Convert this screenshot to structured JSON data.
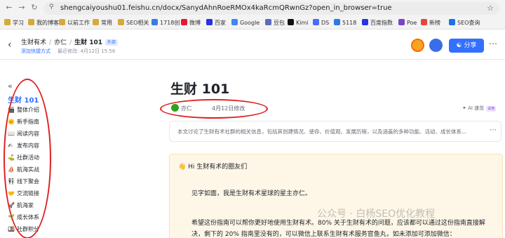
{
  "browser": {
    "url": "shengcaiyoushu01.feishu.cn/docx/SanydAhnRoeRMOx4kaRcmQRwnGz?open_in_browser=true",
    "bookmarks": [
      "学习",
      "我的博客",
      "以前工作",
      "常用",
      "SEO相关",
      "1718创",
      "微博",
      "百家",
      "Google",
      "豆包",
      "Kimi",
      "DS",
      "5118",
      "百度指数",
      "Poe",
      "新榜",
      "SEO查询"
    ]
  },
  "header": {
    "breadcrumb": [
      "生财有术",
      "亦仁",
      "生财 101"
    ],
    "external_badge": "外部",
    "add_shortcut": "添加快捷方式",
    "last_modified": "最近修改: 4月12日 15:56",
    "share_label": "分享"
  },
  "sidebar": {
    "title": "生财 101",
    "items": [
      {
        "emoji": "🎬",
        "label": "整体介绍"
      },
      {
        "emoji": "🌞",
        "label": "新手指南"
      },
      {
        "emoji": "📖",
        "label": "阅读内容"
      },
      {
        "emoji": "✍",
        "label": "发布内容"
      },
      {
        "emoji": "⛳",
        "label": "社群活动"
      },
      {
        "emoji": "⛵",
        "label": "航海实战"
      },
      {
        "emoji": "👫",
        "label": "线下聚会"
      },
      {
        "emoji": "🤝",
        "label": "交流链接"
      },
      {
        "emoji": "🚀",
        "label": "航海家"
      },
      {
        "emoji": "🌱",
        "label": "成长体系"
      },
      {
        "emoji": "🍱",
        "label": "社群积分"
      }
    ]
  },
  "doc": {
    "title": "生财 101",
    "author": "亦仁",
    "modified": "4月12日修改",
    "ai_label": "AI 速览",
    "ai_badge": "试用",
    "summary": "本文讨论了生财有术社群的相关信息，包括其创建情况、使命、价值观、发展历程，以及涵盖的多种功能、活动、成长体系...",
    "callout_title": "Hi 生财有术的圈友们",
    "para1": "见字如面，我是生财有术星球的星主亦仁。",
    "para2": "希望这份指南可以帮你更好地使用生财有术。80% 关于生财有术的问题，应该都可以通过这份指南直接解",
    "para3": "决，剩下的 20% 指南里没有的，可以微信上联系生财有术服务官鱼丸，如未添加可添加微信："
  },
  "watermark": "公众号 · 白杨SEO优化教程",
  "colors": {
    "accent": "#3370ff",
    "annotation": "#e02020",
    "callout_bg": "#fef7e8"
  }
}
